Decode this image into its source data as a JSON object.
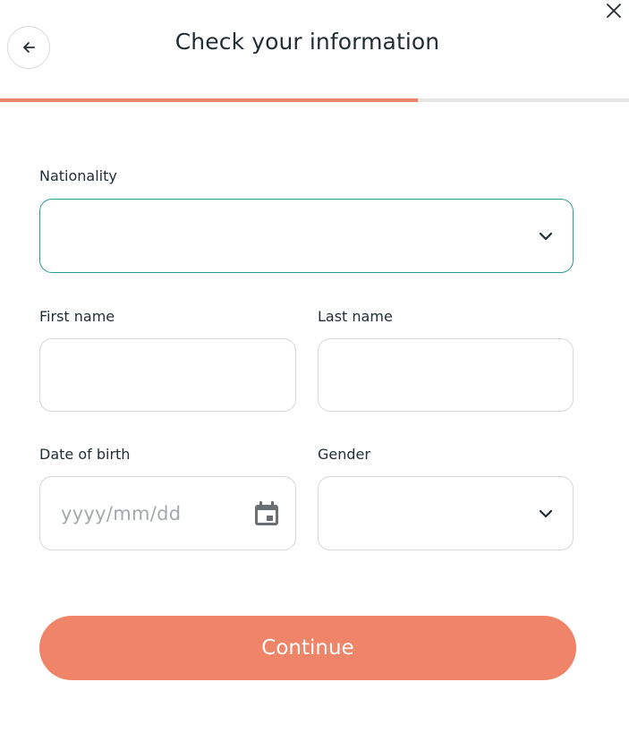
{
  "header": {
    "title": "Check your information",
    "back_icon": "arrow-left-icon",
    "close_icon": "close-icon"
  },
  "progress": {
    "value": 0.665,
    "fill_color": "#ef8468",
    "track_color": "#e6e6e6"
  },
  "form": {
    "nationality": {
      "label": "Nationality",
      "value": ""
    },
    "first_name": {
      "label": "First name",
      "value": ""
    },
    "last_name": {
      "label": "Last name",
      "value": ""
    },
    "date_of_birth": {
      "label": "Date of birth",
      "placeholder": "yyyy/mm/dd",
      "icon": "calendar-icon"
    },
    "gender": {
      "label": "Gender",
      "value": ""
    }
  },
  "actions": {
    "continue_label": "Continue"
  },
  "colors": {
    "accent": "#ef8468",
    "focus": "#2a9d8f",
    "text": "#1f2d33",
    "placeholder": "#a3a9ad",
    "border": "#d6d6d6"
  }
}
